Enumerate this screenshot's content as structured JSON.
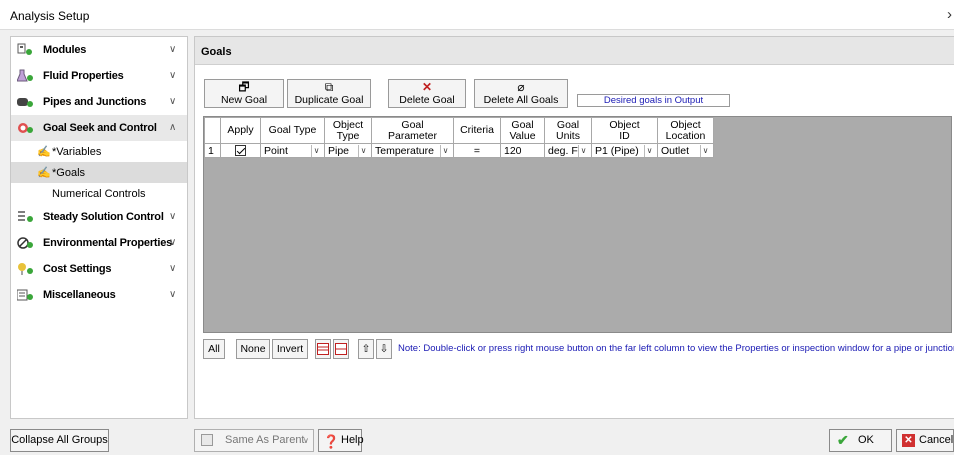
{
  "window": {
    "title": "Analysis Setup",
    "close_glyph": "›"
  },
  "sidebar": {
    "groups": [
      {
        "label": "Modules",
        "icon": "modules-icon",
        "chevron": "∨"
      },
      {
        "label": "Fluid Properties",
        "icon": "flask-icon",
        "chevron": "∨"
      },
      {
        "label": "Pipes and Junctions",
        "icon": "pipe-icon",
        "chevron": "∨"
      },
      {
        "label": "Goal Seek and Control",
        "icon": "target-icon",
        "chevron": "∧"
      },
      {
        "label": "Steady Solution Control",
        "icon": "solution-icon",
        "chevron": "∨"
      },
      {
        "label": "Environmental Properties",
        "icon": "environment-icon",
        "chevron": "∨"
      },
      {
        "label": "Cost Settings",
        "icon": "cost-icon",
        "chevron": "∨"
      },
      {
        "label": "Miscellaneous",
        "icon": "misc-icon",
        "chevron": "∨"
      }
    ],
    "sub_items": [
      {
        "label": "*Variables",
        "icon": "variable-icon"
      },
      {
        "label": "*Goals",
        "icon": "goal-icon"
      },
      {
        "label": "Numerical Controls"
      }
    ]
  },
  "panel": {
    "title": "Goals",
    "toolbar": {
      "new_goal": "New Goal",
      "duplicate_goal": "Duplicate Goal",
      "delete_goal": "Delete Goal",
      "delete_all_goals": "Delete All Goals",
      "desired_note": "Desired goals in Output"
    },
    "table": {
      "headers": [
        "",
        "Apply",
        "Goal Type",
        "Object\nType",
        "Goal\nParameter",
        "Criteria",
        "Goal\nValue",
        "Goal\nUnits",
        "Object\nID",
        "Object\nLocation"
      ],
      "rows": [
        {
          "num": "1",
          "apply": true,
          "goal_type": "Point",
          "object_type": "Pipe",
          "goal_parameter": "Temperature",
          "criteria": "=",
          "goal_value": "120",
          "goal_units": "deg. F",
          "object_id": "P1 (Pipe)",
          "object_location": "Outlet"
        }
      ]
    },
    "bottom": {
      "all": "All",
      "none": "None",
      "invert": "Invert",
      "note": "Note: Double-click or press right mouse button on the far left column to view the Properties or inspection window for a pipe or junction."
    }
  },
  "footer": {
    "collapse_all": "Collapse All Groups",
    "same_as_parent": "Same As Parent",
    "help": "Help",
    "ok": "OK",
    "cancel": "Cancel"
  },
  "colors": {
    "accent_green": "#3aa63a",
    "note_blue": "#1a1ab4",
    "cancel_red": "#d03030"
  }
}
